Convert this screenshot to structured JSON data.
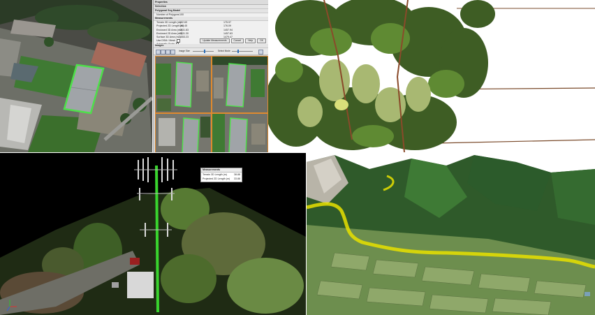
{
  "panel": {
    "window_title": "Properties",
    "subtitle": "Selection",
    "section_1": "Polygonal Seg Model",
    "setting_label": "Number of Polygons",
    "setting_value": "100",
    "section_2": "Measurements",
    "rows": [
      {
        "label": "Terrain 3D Length (m)",
        "v1": "182.69",
        "v2": "175.97"
      },
      {
        "label": "Projected 2D Length (m)",
        "v1": "182.45",
        "v2": "176.09"
      },
      {
        "label": "Enclosed 3D Area (m2)",
        "v1": "1531.83",
        "v2": "1457.94"
      },
      {
        "label": "Enclosed 2D Area (m2)",
        "v1": "1531.30",
        "v2": "1457.63"
      },
      {
        "label": "Surface 3D Area (m2)",
        "v1": "1553.23",
        "v2": "1479.47"
      }
    ],
    "check_rows": [
      "Use DSM / Mesh",
      "Automatic Scale"
    ],
    "buttons": {
      "update": "Update Measurements",
      "cancel": "Cancel",
      "help": "Help",
      "ok": "OK"
    },
    "images_section": "Images",
    "toolbar": {
      "label_a": "Image Size",
      "label_b": "Select Mode"
    }
  },
  "measure_box": {
    "title": "Measurements",
    "rows": [
      {
        "label": "Terrain 3D Length (m)",
        "value": "38.88"
      },
      {
        "label": "Projected 2D Length (m)",
        "value": "33.88"
      }
    ]
  },
  "colors": {
    "highlight_green": "#4ee04a",
    "selection_orange": "#e08a2e",
    "river_yellow": "#e8e000",
    "tower_green": "#39d42e"
  }
}
